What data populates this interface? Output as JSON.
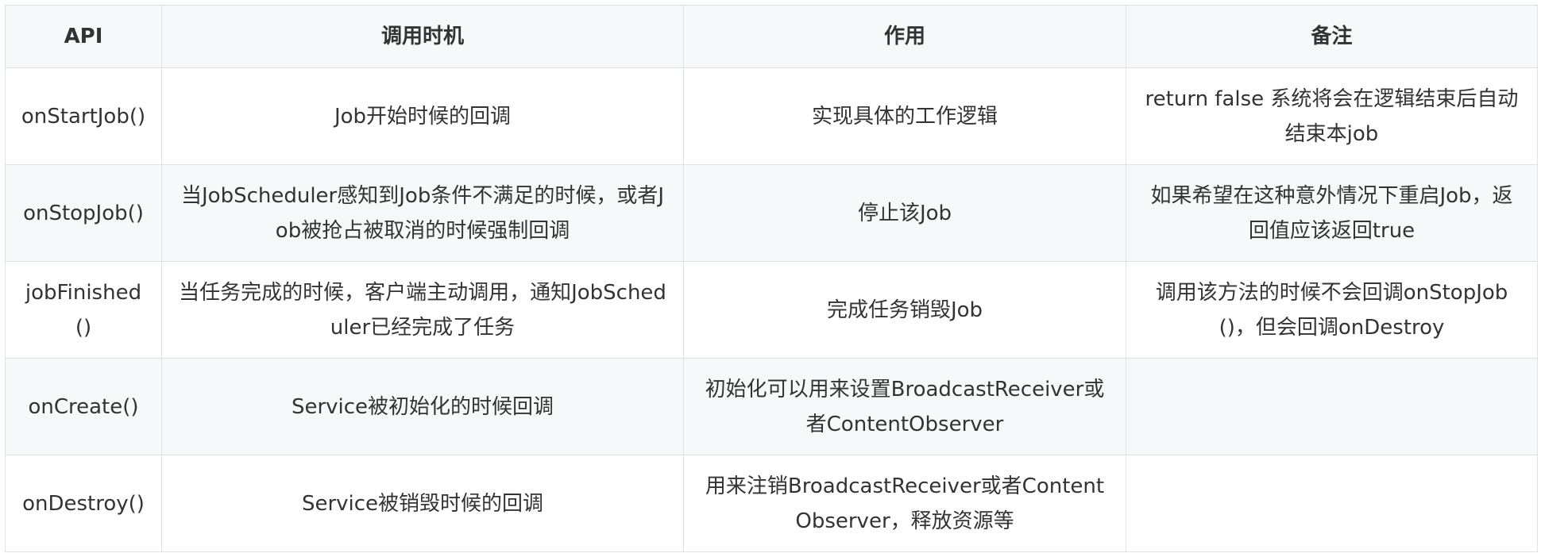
{
  "table": {
    "headers": [
      "API",
      "调用时机",
      "作用",
      "备注"
    ],
    "rows": [
      [
        "onStartJob()",
        "Job开始时候的回调",
        "实现具体的工作逻辑",
        "return false 系统将会在逻辑结束后自动结束本job"
      ],
      [
        "onStopJob()",
        "当JobScheduler感知到Job条件不满足的时候，或者Job被抢占被取消的时候强制回调",
        "停止该Job",
        "如果希望在这种意外情况下重启Job，返回值应该返回true"
      ],
      [
        "jobFinished()",
        "当任务完成的时候，客户端主动调用，通知JobScheduler已经完成了任务",
        "完成任务销毁Job",
        "调用该方法的时候不会回调onStopJob()，但会回调onDestroy"
      ],
      [
        "onCreate()",
        "Service被初始化的时候回调",
        "初始化可以用来设置BroadcastReceiver或者ContentObserver",
        ""
      ],
      [
        "onDestroy()",
        "Service被销毁时候的回调",
        "用来注销BroadcastReceiver或者ContentObserver，释放资源等",
        ""
      ]
    ]
  }
}
